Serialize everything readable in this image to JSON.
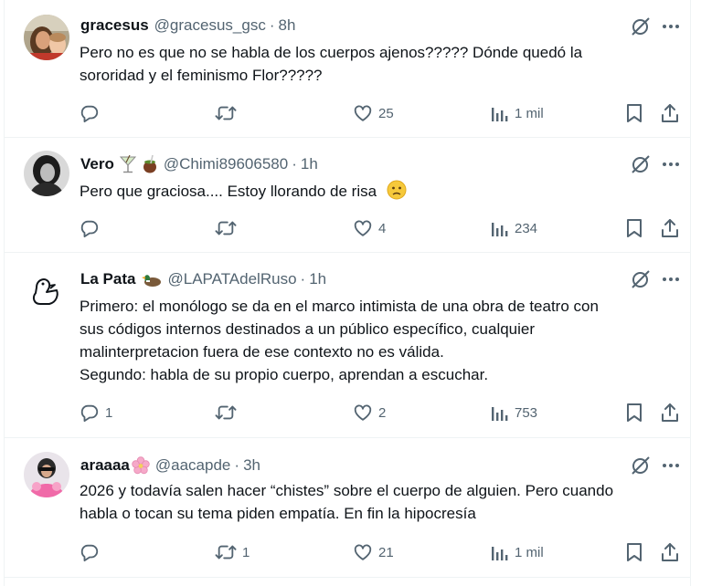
{
  "tweets": [
    {
      "name": "gracesus",
      "handle": "@gracesus_gsc",
      "sep": "·",
      "time": "8h",
      "lines": [
        "Pero no es que no se habla de los cuerpos ajenos????? Dónde quedó la",
        "sororidad y el feminismo Flor?????"
      ],
      "replies": "",
      "retweets": "",
      "likes": "25",
      "views": "1 mil"
    },
    {
      "name": "Vero",
      "handle": "@Chimi89606580",
      "sep": "·",
      "time": "1h",
      "lines": [
        "Pero que graciosa.... Estoy llorando de risa"
      ],
      "replies": "",
      "retweets": "",
      "likes": "4",
      "views": "234"
    },
    {
      "name": "La Pata",
      "handle": "@LAPATAdelRuso",
      "sep": "·",
      "time": "1h",
      "lines": [
        "Primero: el monólogo se da en el marco intimista de una obra de teatro con",
        "sus códigos internos destinados a un público específico, cualquier",
        "malinterpretacion fuera de ese contexto no es válida.",
        "Segundo: habla de su propio cuerpo, aprendan a escuchar."
      ],
      "replies": "1",
      "retweets": "",
      "likes": "2",
      "views": "753"
    },
    {
      "name": "araaaa",
      "handle": "@aacapde",
      "sep": "·",
      "time": "3h",
      "lines": [
        "2026 y todavía salen hacer “chistes” sobre el cuerpo de alguien. Pero cuando",
        "habla o tocan su tema piden empatía. En fin la hipocresía"
      ],
      "replies": "",
      "retweets": "1",
      "likes": "21",
      "views": "1 mil"
    }
  ],
  "colors": {
    "text": "#0f1419",
    "secondary": "#536471",
    "divider": "#eff3f4"
  },
  "icons": [
    "grok-icon",
    "more-icon",
    "reply-icon",
    "retweet-icon",
    "like-icon",
    "views-icon",
    "bookmark-icon",
    "share-icon"
  ]
}
